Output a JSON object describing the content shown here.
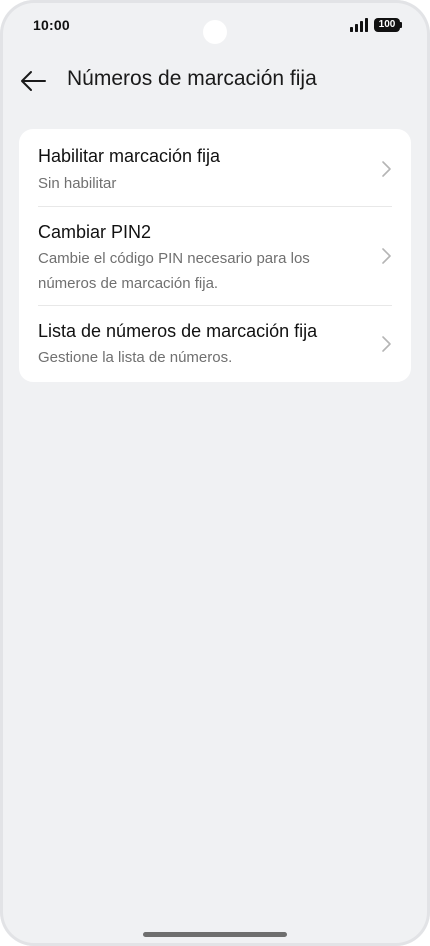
{
  "status_bar": {
    "time": "10:00",
    "battery": "100",
    "icons": [
      "signal-icon",
      "battery-icon"
    ]
  },
  "header": {
    "back_icon": "arrow-left-icon",
    "title": "Números de marcación fija"
  },
  "settings": {
    "items": [
      {
        "title": "Habilitar marcación fija",
        "subtitle": "Sin habilitar",
        "icon": "chevron-right-icon"
      },
      {
        "title": "Cambiar PIN2",
        "subtitle": "Cambie el código PIN necesario para los números de marcación fija.",
        "icon": "chevron-right-icon"
      },
      {
        "title": "Lista de números de marcación fija",
        "subtitle": "Gestione la lista de números.",
        "icon": "chevron-right-icon"
      }
    ]
  },
  "colors": {
    "background": "#f0f1f3",
    "card": "#ffffff",
    "title_text": "#111111",
    "subtitle_text": "#707070",
    "chevron": "#b5b5b5"
  }
}
